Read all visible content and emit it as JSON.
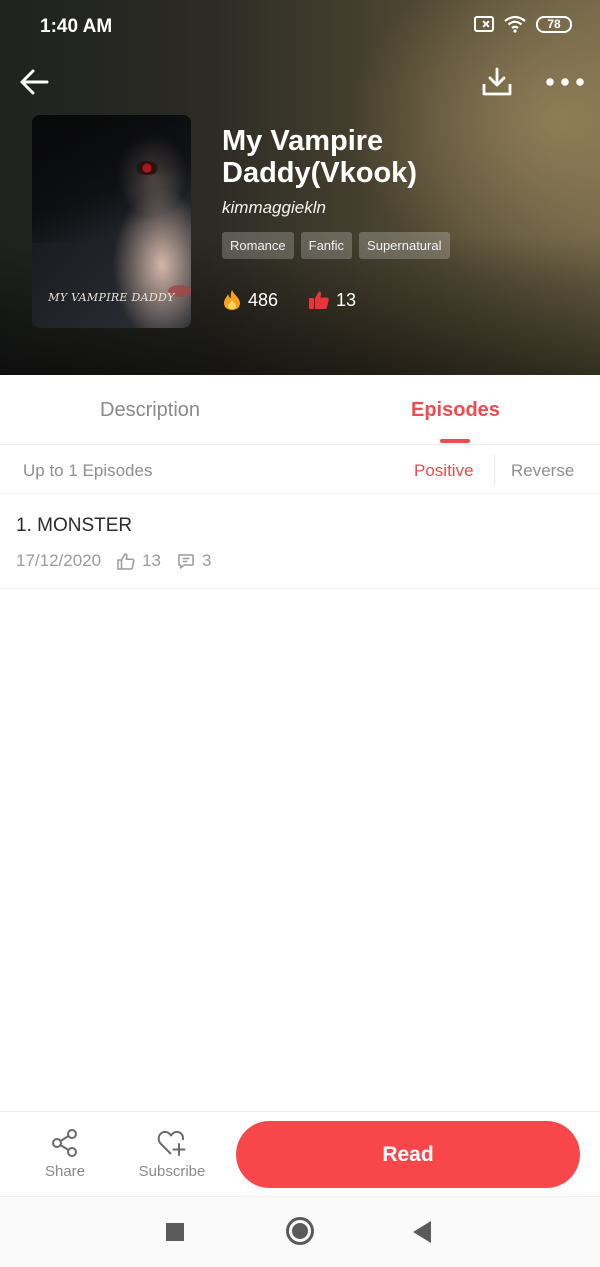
{
  "status_bar": {
    "time": "1:40 AM",
    "battery": "78"
  },
  "book": {
    "title": "My Vampire Daddy(Vkook)",
    "author": "kimmaggiekln",
    "cover_text": "MY VAMPIRE DADDY",
    "tags": [
      "Romance",
      "Fanfic",
      "Supernatural"
    ],
    "views": "486",
    "likes": "13"
  },
  "tabs": {
    "description": "Description",
    "episodes": "Episodes",
    "active": "episodes"
  },
  "episodes_header": {
    "count_label": "Up to 1 Episodes",
    "sort_positive": "Positive",
    "sort_reverse": "Reverse",
    "active_sort": "positive"
  },
  "episodes": [
    {
      "title": "1. MONSTER",
      "date": "17/12/2020",
      "likes": "13",
      "comments": "3"
    }
  ],
  "actions": {
    "share": "Share",
    "subscribe": "Subscribe",
    "read": "Read"
  },
  "icons": [
    "back-arrow-icon",
    "download-icon",
    "more-dots-icon",
    "fire-icon",
    "thumbs-up-icon",
    "like-outline-icon",
    "comment-icon",
    "share-icon",
    "heart-plus-icon"
  ],
  "colors": {
    "accent": "#f8474b",
    "accent_text": "#ef4b4f",
    "muted": "#8f8f8f"
  }
}
